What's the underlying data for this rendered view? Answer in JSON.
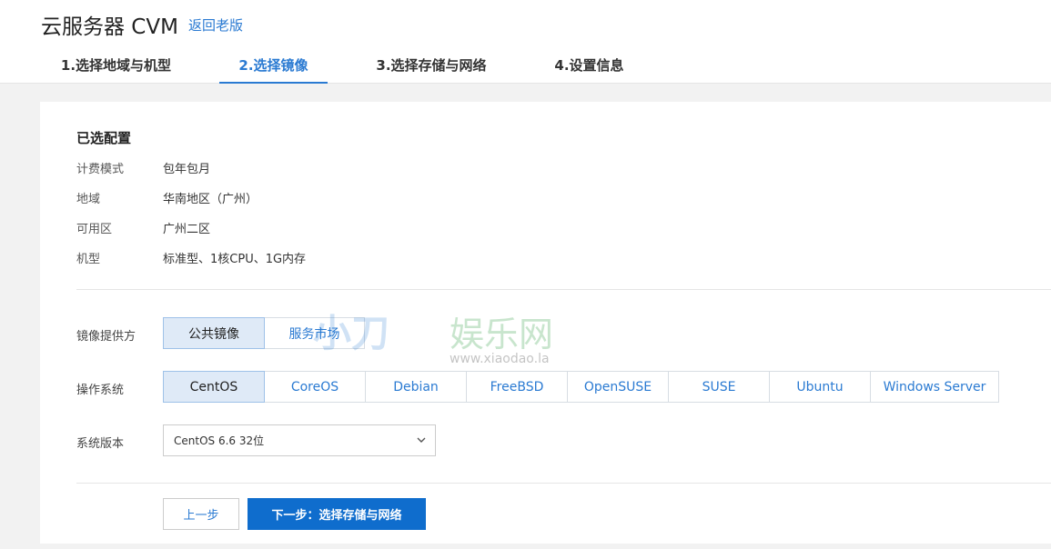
{
  "header": {
    "title": "云服务器 CVM",
    "back_link": "返回老版"
  },
  "steps": [
    {
      "label": "1.选择地域与机型"
    },
    {
      "label": "2.选择镜像"
    },
    {
      "label": "3.选择存储与网络"
    },
    {
      "label": "4.设置信息"
    }
  ],
  "selected_config": {
    "title": "已选配置",
    "rows": [
      {
        "label": "计费模式",
        "value": "包年包月"
      },
      {
        "label": "地域",
        "value": "华南地区（广州）"
      },
      {
        "label": "可用区",
        "value": "广州二区"
      },
      {
        "label": "机型",
        "value": "标准型、1核CPU、1G内存"
      }
    ]
  },
  "image_provider": {
    "label": "镜像提供方",
    "options": [
      "公共镜像",
      "服务市场"
    ],
    "selected": "公共镜像"
  },
  "os": {
    "label": "操作系统",
    "options": [
      "CentOS",
      "CoreOS",
      "Debian",
      "FreeBSD",
      "OpenSUSE",
      "SUSE",
      "Ubuntu",
      "Windows Server"
    ],
    "selected": "CentOS"
  },
  "version": {
    "label": "系统版本",
    "value": "CentOS 6.6 32位"
  },
  "actions": {
    "prev": "上一步",
    "next": "下一步：选择存储与网络"
  },
  "watermark": {
    "text": "小刀娱乐网",
    "url": "www.xiaodao.la"
  },
  "colors": {
    "accent": "#2a7ad2",
    "primary_button": "#0f6dcd",
    "selected_bg": "#dfeaf7"
  }
}
